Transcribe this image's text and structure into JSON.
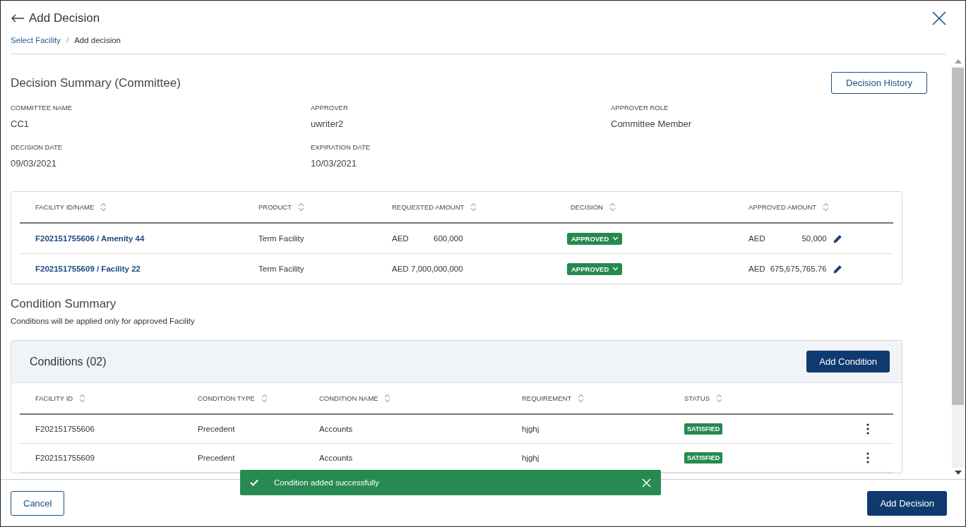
{
  "header": {
    "title": "Add Decision",
    "separator": "/",
    "breadcrumbs": [
      {
        "label": "Select Facility",
        "link": true
      },
      {
        "label": "Add decision",
        "link": false
      }
    ]
  },
  "summary": {
    "title": "Decision Summary (Committee)",
    "history_button": "Decision History",
    "fields": [
      {
        "label": "COMMITTEE NAME",
        "value": "CC1"
      },
      {
        "label": "APPROVER",
        "value": "uwriter2"
      },
      {
        "label": "APPROVER ROLE",
        "value": "Committee Member"
      },
      {
        "label": "DECISION DATE",
        "value": "09/03/2021"
      },
      {
        "label": "EXPIRATION DATE",
        "value": "10/03/2021"
      }
    ]
  },
  "facilities": {
    "columns": [
      "FACILITY ID/NAME",
      "PRODUCT",
      "REQUESTED AMOUNT",
      "DECISION",
      "APPROVED AMOUNT"
    ],
    "rows": [
      {
        "facility": "F202151755606 / Amenity 44",
        "product": "Term Facility",
        "requested_currency": "AED",
        "requested_amount": "600,000",
        "decision": "APPROVED",
        "approved_currency": "AED",
        "approved_amount": "50,000"
      },
      {
        "facility": "F202151755609 / Facility 22",
        "product": "Term Facility",
        "requested_currency": "AED",
        "requested_amount": "7,000,000,000",
        "decision": "APPROVED",
        "approved_currency": "AED",
        "approved_amount": "675,675,765.76"
      }
    ]
  },
  "condition_summary": {
    "title": "Condition Summary",
    "note": "Conditions will be applied only for approved Facility"
  },
  "conditions": {
    "title": "Conditions (02)",
    "add_button": "Add Condition",
    "columns": [
      "FACILITY ID",
      "CONDITION TYPE",
      "CONDITION NAME",
      "REQUIREMENT",
      "STATUS"
    ],
    "rows": [
      {
        "facility_id": "F202151755606",
        "type": "Precedent",
        "name": "Accounts",
        "requirement": "hjghj",
        "status": "SATISFIED"
      },
      {
        "facility_id": "F202151755609",
        "type": "Precedent",
        "name": "Accounts",
        "requirement": "hjghj",
        "status": "SATISFIED"
      }
    ]
  },
  "footer": {
    "cancel": "Cancel",
    "submit": "Add Decision"
  },
  "toast": {
    "message": "Condition added successfully"
  }
}
